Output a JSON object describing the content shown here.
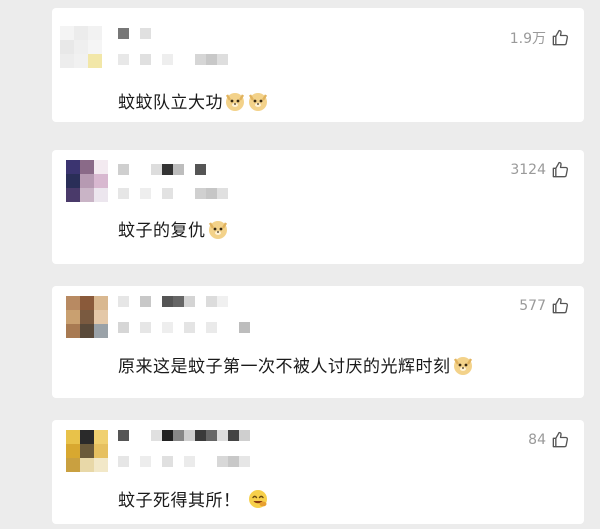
{
  "comments": [
    {
      "likes": "1.9万",
      "text": "蚊蚊队立大功",
      "emoji": "doge-emoji ×2"
    },
    {
      "likes": "3124",
      "text": "蚊子的复仇",
      "emoji": "doge-emoji"
    },
    {
      "likes": "577",
      "text": "原来这是蚊子第一次不被人讨厌的光辉时刻",
      "emoji": "doge-emoji"
    },
    {
      "likes": "84",
      "text": "蚊子死得其所！",
      "emoji": "laughing-face-emoji"
    }
  ],
  "colors": {
    "background": "#ececec",
    "card": "#ffffff",
    "text": "#1a1a1a",
    "meta": "#9a9a9a"
  },
  "icons": [
    "thumbs-up-icon",
    "doge-emoji",
    "laughing-face-emoji"
  ]
}
